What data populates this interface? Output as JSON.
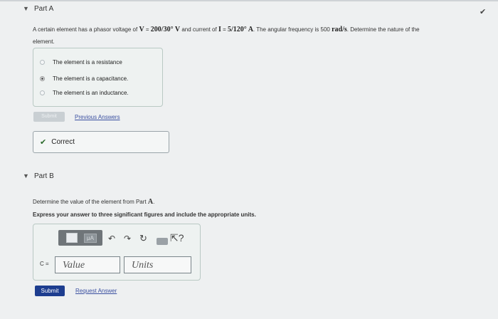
{
  "part_a": {
    "title": "Part A",
    "question_prefix": "A certain element has a phasor voltage of ",
    "v_symbol": "V",
    "eq1": " = ",
    "v_value": "200/30° V",
    "mid_text": " and current of ",
    "i_symbol": "I",
    "eq2": " = ",
    "i_value": "5/120° A",
    "suffix1": ". The angular frequency is 500 ",
    "unit": "rad/s",
    "suffix2": ". Determine the nature of the",
    "line2": "element.",
    "choices": [
      {
        "label": "The element is a resistance",
        "selected": false
      },
      {
        "label": "The element is a capacitance.",
        "selected": true
      },
      {
        "label": "The element is an inductance.",
        "selected": false
      }
    ],
    "submit_label": "Submit",
    "previous_answers_label": "Previous Answers",
    "feedback": "Correct"
  },
  "part_b": {
    "title": "Part B",
    "question_prefix": "Determine the value of the element from Part ",
    "question_ref": "A",
    "question_suffix": ".",
    "instruction": "Express your answer to three significant figures and include the appropriate units.",
    "toolbar": {
      "unit_button": "μA"
    },
    "variable_label": "C =",
    "value_placeholder": "Value",
    "units_placeholder": "Units",
    "submit_label": "Submit",
    "request_answer_label": "Request Answer"
  },
  "colors": {
    "link": "#3a4fa0",
    "submit": "#1d3d8f",
    "correct": "#2b6a2b"
  }
}
